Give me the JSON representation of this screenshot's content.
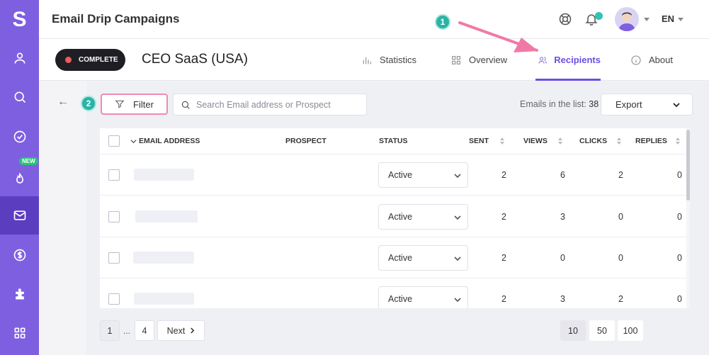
{
  "app": {
    "logo_letter": "S",
    "title": "Email Drip Campaigns",
    "language": "EN"
  },
  "sidebar": {
    "new_badge": "NEW",
    "items": [
      {
        "icon": "user-icon"
      },
      {
        "icon": "search-icon"
      },
      {
        "icon": "check-circle-icon"
      },
      {
        "icon": "flame-icon"
      },
      {
        "icon": "mail-icon"
      },
      {
        "icon": "dollar-icon"
      },
      {
        "icon": "puzzle-icon"
      },
      {
        "icon": "apps-grid-icon"
      }
    ]
  },
  "campaign": {
    "status": "COMPLETE",
    "name": "CEO SaaS (USA)",
    "tabs": [
      {
        "label": "Statistics"
      },
      {
        "label": "Overview"
      },
      {
        "label": "Recipients"
      },
      {
        "label": "About"
      }
    ],
    "active_tab": "Recipients"
  },
  "annotations": {
    "step1": "1",
    "step2": "2",
    "color": "#f07aa6"
  },
  "toolbar": {
    "filter_label": "Filter",
    "search_placeholder": "Search Email address or Prospect",
    "emails_label": "Emails in the list:",
    "emails_count": "38",
    "export_label": "Export"
  },
  "table": {
    "columns": {
      "email": "EMAIL ADDRESS",
      "prospect": "PROSPECT",
      "status": "STATUS",
      "sent": "SENT",
      "views": "VIEWS",
      "clicks": "CLICKS",
      "replies": "REPLIES"
    },
    "rows": [
      {
        "status": "Active",
        "sent": "2",
        "views": "6",
        "clicks": "2",
        "replies": "0"
      },
      {
        "status": "Active",
        "sent": "2",
        "views": "3",
        "clicks": "0",
        "replies": "0"
      },
      {
        "status": "Active",
        "sent": "2",
        "views": "0",
        "clicks": "0",
        "replies": "0"
      },
      {
        "status": "Active",
        "sent": "2",
        "views": "3",
        "clicks": "2",
        "replies": "0"
      }
    ]
  },
  "pagination": {
    "pages": {
      "first": "1",
      "ellipsis": "...",
      "last": "4"
    },
    "next_label": "Next",
    "page_sizes": [
      "10",
      "50",
      "100"
    ],
    "selected_page_size": "10"
  },
  "colors": {
    "brand": "#7e5fe0",
    "brand_dark": "#5b3dbf",
    "accent_tab": "#6b4fe0",
    "teal": "#2ab3a6"
  }
}
